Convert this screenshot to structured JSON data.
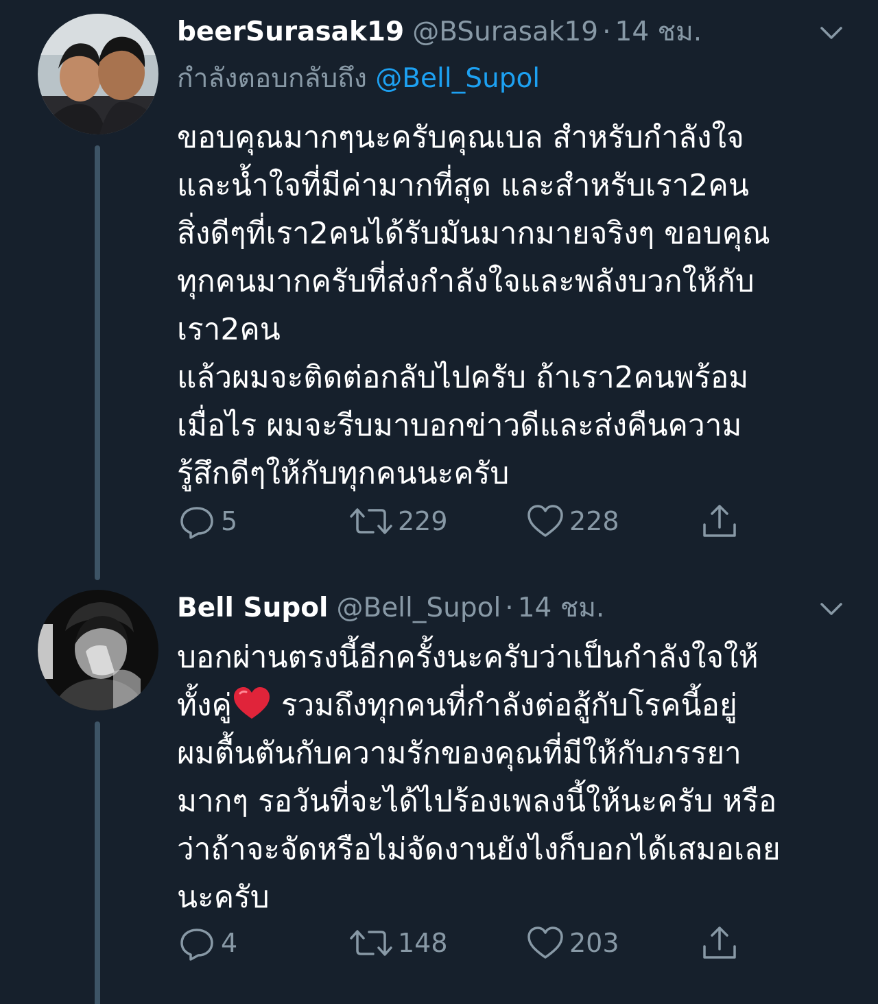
{
  "colors": {
    "background": "#16202c",
    "text_primary": "#ffffff",
    "text_secondary": "#8899a6",
    "mention": "#1da1f2",
    "thread_line": "#3d5466",
    "heart_emoji": "#e0243a"
  },
  "tweets": [
    {
      "display_name": "beerSurasak19",
      "handle": "@BSurasak19",
      "separator": "·",
      "time": "14 ชม.",
      "reply_prefix": "กำลังตอบกลับถึง",
      "reply_mention": "@Bell_Supol",
      "text": "ขอบคุณมากๆนะครับคุณเบล สำหรับกำลังใจ\nและน้ำใจที่มีค่ามากที่สุด และสำหรับเรา2คน\nสิ่งดีๆที่เรา2คนได้รับมันมากมายจริงๆ ขอบคุณ\nทุกคนมากครับที่ส่งกำลังใจและพลังบวกให้กับ\nเรา2คน\nแล้วผมจะติดต่อกลับไปครับ ถ้าเรา2คนพร้อม\nเมื่อไร ผมจะรีบมาบอกข่าวดีและส่งคืนความ\nรู้สึกดีๆให้กับทุกคนนะครับ",
      "replies": "5",
      "retweets": "229",
      "likes": "228",
      "icons": {
        "avatar": "avatar-couple-photo",
        "menu": "chevron-down-icon",
        "reply": "reply-icon",
        "retweet": "retweet-icon",
        "like": "heart-icon",
        "share": "share-icon"
      }
    },
    {
      "display_name": "Bell Supol",
      "handle": "@Bell_Supol",
      "separator": "·",
      "time": "14 ชม.",
      "text_part1": "บอกผ่านตรงนี้อีกครั้งนะครับว่าเป็นกำลังใจให้\nทั้งคู่",
      "text_part2": " รวมถึงทุกคนที่กำลังต่อสู้กับโรคนี้อยู่\nผมตื้นตันกับความรักของคุณที่มีให้กับภรรยา\nมากๆ รอวันที่จะได้ไปร้องเพลงนี้ให้นะครับ หรือ\nว่าถ้าจะจัดหรือไม่จัดงานยังไงก็บอกได้เสมอเลย\nนะครับ",
      "replies": "4",
      "retweets": "148",
      "likes": "203",
      "icons": {
        "avatar": "avatar-bw-portrait",
        "menu": "chevron-down-icon",
        "heart_emoji": "red-heart-emoji-icon",
        "reply": "reply-icon",
        "retweet": "retweet-icon",
        "like": "heart-icon",
        "share": "share-icon"
      }
    }
  ]
}
